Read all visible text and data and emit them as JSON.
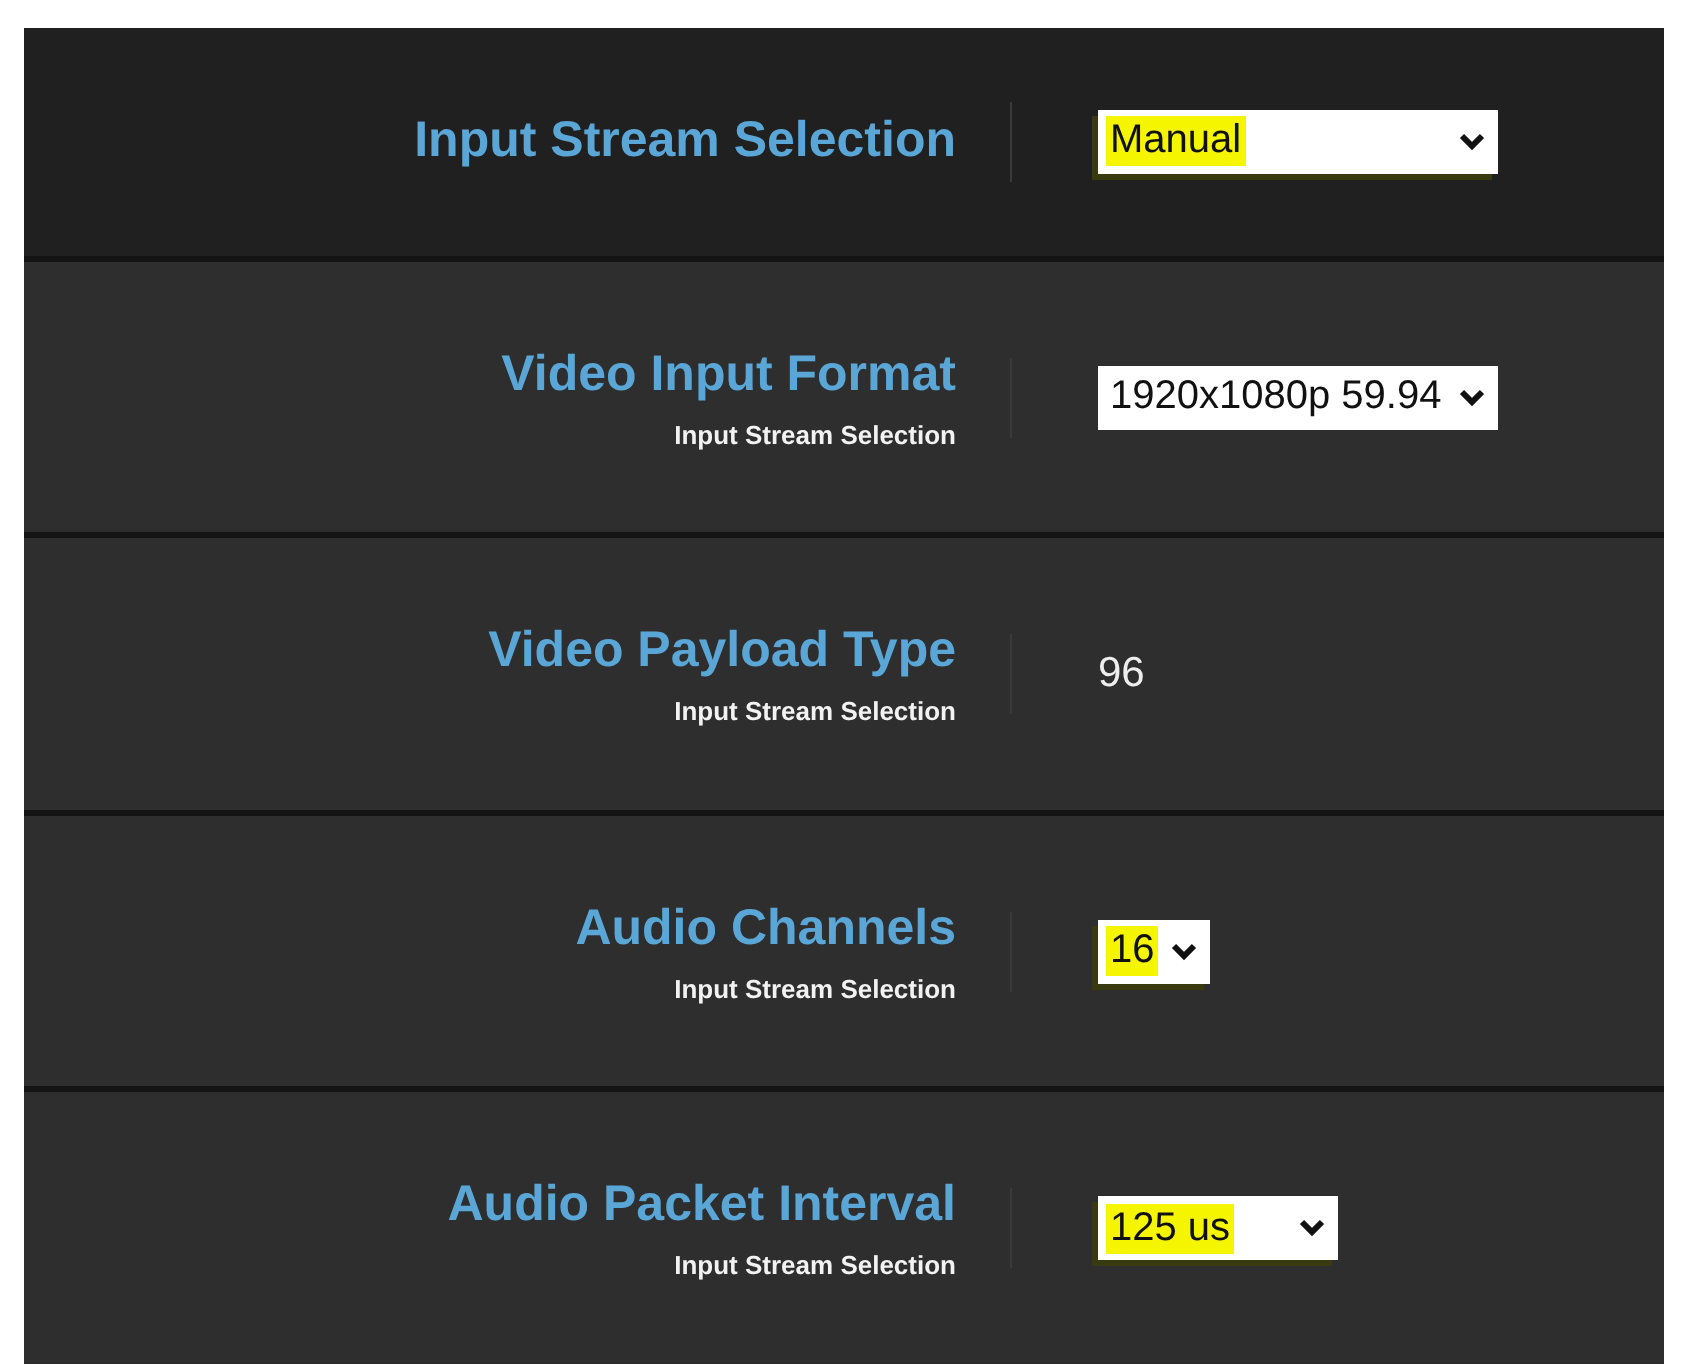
{
  "settings": [
    {
      "label": "Input Stream Selection",
      "kind": "select",
      "value": "Manual",
      "highlighted": true
    },
    {
      "label": "Video Input Format",
      "sublabel": "Input Stream Selection",
      "kind": "select",
      "value": "1920x1080p 59.94",
      "highlighted": false
    },
    {
      "label": "Video Payload Type",
      "sublabel": "Input Stream Selection",
      "kind": "text",
      "value": "96"
    },
    {
      "label": "Audio Channels",
      "sublabel": "Input Stream Selection",
      "kind": "select",
      "value": "16",
      "highlighted": true
    },
    {
      "label": "Audio Packet Interval",
      "sublabel": "Input Stream Selection",
      "kind": "select",
      "value": "125 us",
      "highlighted": true
    }
  ]
}
